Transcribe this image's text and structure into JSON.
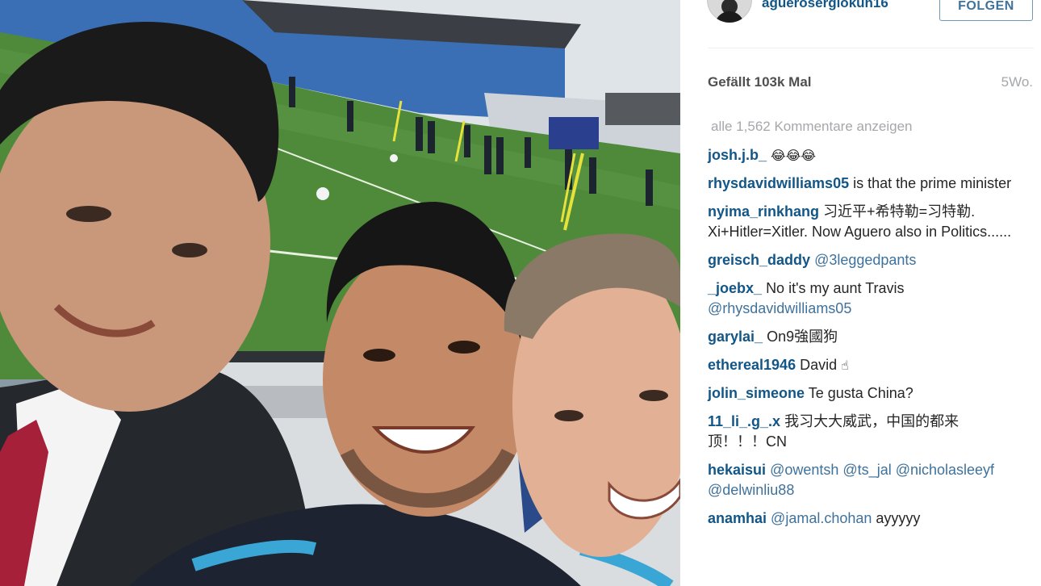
{
  "post": {
    "username": "aguerosergiokun16",
    "follow_label": "FOLGEN",
    "likes": "Gefällt 103k Mal",
    "age": "5Wo.",
    "view_all": "alle 1,562 Kommentare anzeigen"
  },
  "comments": [
    {
      "user": "josh.j.b_",
      "parts": [
        {
          "t": "glyph",
          "v": "😂😂😂"
        }
      ]
    },
    {
      "user": "rhysdavidwilliams05",
      "parts": [
        {
          "t": "text",
          "v": "is that the prime minister"
        }
      ]
    },
    {
      "user": "nyima_rinkhang",
      "parts": [
        {
          "t": "text",
          "v": "习近平+希特勒=习特勒. Xi+Hitler=Xitler. Now Aguero also in Politics......"
        }
      ]
    },
    {
      "user": "greisch_daddy",
      "parts": [
        {
          "t": "mention",
          "v": "@3leggedpants"
        }
      ]
    },
    {
      "user": "_joebx_",
      "parts": [
        {
          "t": "text",
          "v": "No it's my aunt Travis"
        },
        {
          "t": "mention",
          "v": "@rhysdavidwilliams05"
        }
      ]
    },
    {
      "user": "garylai_",
      "parts": [
        {
          "t": "text",
          "v": "On9強國狗"
        }
      ]
    },
    {
      "user": "ethereal1946",
      "parts": [
        {
          "t": "text",
          "v": "David"
        },
        {
          "t": "glyph",
          "v": "☝"
        }
      ]
    },
    {
      "user": "jolin_simeone",
      "parts": [
        {
          "t": "text",
          "v": "Te gusta China?"
        }
      ]
    },
    {
      "user": "11_li_.g_.x",
      "parts": [
        {
          "t": "text",
          "v": "我习大大威武，中国的都来顶！！！CN"
        }
      ]
    },
    {
      "user": "hekaisui",
      "parts": [
        {
          "t": "mention",
          "v": "@owentsh"
        },
        {
          "t": "mention",
          "v": "@ts_jal"
        },
        {
          "t": "mention",
          "v": "@nicholasleeyf"
        },
        {
          "t": "mention",
          "v": "@delwinliu88"
        }
      ]
    },
    {
      "user": "anamhai",
      "parts": [
        {
          "t": "mention",
          "v": "@jamal.chohan"
        },
        {
          "t": "text",
          "v": "ayyyyy"
        }
      ]
    }
  ],
  "colors": {
    "username": "#125688",
    "mention": "#3f729b",
    "muted": "#a5a7aa",
    "grass": "#4f8a3a"
  }
}
